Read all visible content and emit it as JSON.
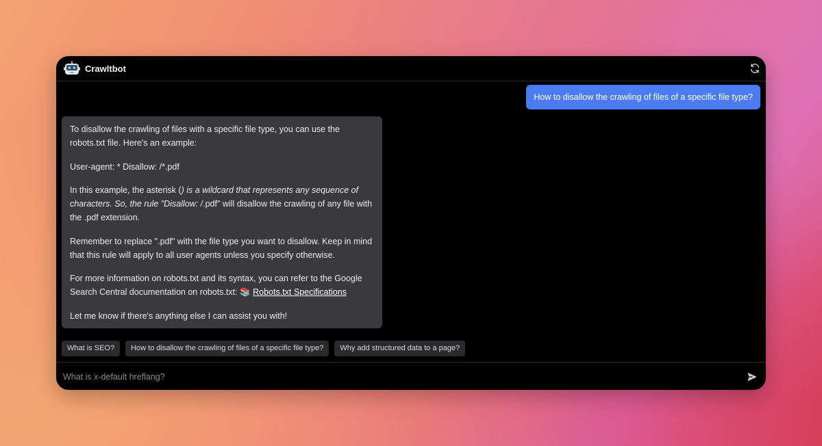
{
  "app": {
    "title": "Crawltbot"
  },
  "conversation": {
    "user_message": "How to disallow the crawling of files of a specific file type?",
    "bot_message": {
      "p1": "To disallow the crawling of files with a specific file type, you can use the robots.txt file. Here's an example:",
      "p2": "User-agent: * Disallow: /*.pdf",
      "p3_a": "In this example, the asterisk (",
      "p3_em": ") is a wildcard that represents any sequence of characters. So, the rule \"Disallow: /",
      "p3_b": ".pdf\" will disallow the crawling of any file with the .pdf extension.",
      "p4": "Remember to replace \".pdf\" with the file type you want to disallow. Keep in mind that this rule will apply to all user agents unless you specify otherwise.",
      "p5_a": "For more information on robots.txt and its syntax, you can refer to the Google Search Central documentation on robots.txt: ",
      "p5_emoji": "📚",
      "p5_link": "Robots.txt Specifications",
      "p6": "Let me know if there's anything else I can assist you with!"
    }
  },
  "suggestions": [
    "What is SEO?",
    "How to disallow the crawling of files of a specific file type?",
    "Why add structured data to a page?"
  ],
  "input": {
    "placeholder": "What is x-default hreflang?"
  },
  "icons": {
    "logo": "robot-logo-icon",
    "refresh": "refresh-icon",
    "send": "send-icon"
  },
  "colors": {
    "user_bubble": "#4b7bf0",
    "bot_bubble": "#3a3a3e",
    "window": "#000000"
  }
}
